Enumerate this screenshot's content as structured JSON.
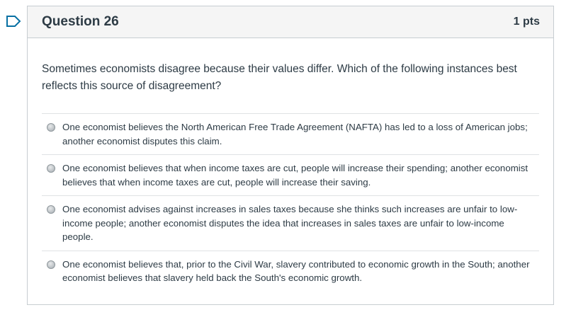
{
  "question": {
    "title": "Question 26",
    "points": "1 pts",
    "text": "Sometimes economists disagree because their values differ.  Which of the following instances best reflects this source of disagreement?",
    "answers": [
      {
        "label": "One economist believes the North American Free Trade Agreement (NAFTA) has led to a loss of American jobs; another economist disputes this claim."
      },
      {
        "label": "One economist believes that when income taxes are cut, people will increase their spending; another economist believes that when income taxes are cut, people will increase their saving."
      },
      {
        "label": "One economist advises against increases in sales taxes because she thinks such increases are unfair to low-income people; another economist disputes the idea that increases in sales taxes are unfair to low-income people."
      },
      {
        "label": "One economist believes that, prior to the Civil War, slavery contributed to economic growth in the South; another economist believes that slavery held back the South's economic growth."
      }
    ]
  },
  "icons": {
    "flag": "flag-outline-icon",
    "radio": "radio-unselected-icon"
  },
  "colors": {
    "accent": "#0770a3",
    "header_bg": "#f5f5f5",
    "border": "#c7cdd1",
    "text": "#2d3b45"
  }
}
